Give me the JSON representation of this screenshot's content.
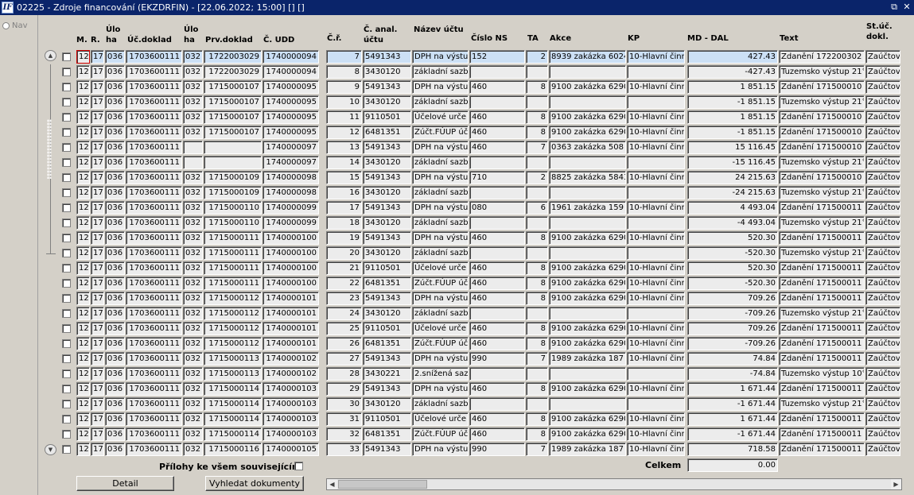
{
  "window": {
    "title": "02225 - Zdroje financování (EKZDRFIN) - [22.06.2022; 15:00] [] []",
    "logo_text": "IF",
    "restore_glyph": "⧉",
    "close_glyph": "✕"
  },
  "nav": {
    "label": "Nav"
  },
  "columns": {
    "m": "M.",
    "r": "R.",
    "uloha1": "Úlo\nha",
    "ucdoklad": "Úč.doklad",
    "uloha2": "Úlo\nha",
    "prvdoklad": "Prv.doklad",
    "cudd": "Č. UDD",
    "cr": "Č.ř.",
    "canal": "Č. anal.\núčtu",
    "nazev": "Název účtu",
    "cislons": "Číslo NS",
    "ta": "TA",
    "akce": "Akce",
    "kp": "KP",
    "mddal": "MD - DAL",
    "text": "Text",
    "stuc": "St.úč.\ndokl."
  },
  "rows": [
    {
      "m": "12",
      "r": "17",
      "u1": "036",
      "ucd": "1703600111",
      "u2": "032",
      "prv": "1722003029",
      "udd": "1740000094",
      "cr": "7",
      "anal": "5491343",
      "naz": "DPH na výstu",
      "ns": "152",
      "ta": "2",
      "akce": "8939 zakázka 6024",
      "kp": "10-Hlavní činn",
      "md": "427.43",
      "txt": "Zdanění 172200302",
      "st": "Zaúčtov"
    },
    {
      "m": "12",
      "r": "17",
      "u1": "036",
      "ucd": "1703600111",
      "u2": "032",
      "prv": "1722003029",
      "udd": "1740000094",
      "cr": "8",
      "anal": "3430120",
      "naz": "základní sazb",
      "ns": "",
      "ta": "",
      "akce": "",
      "kp": "",
      "md": "-427.43",
      "txt": "Tuzemsko výstup 21°",
      "st": "Zaúčtov"
    },
    {
      "m": "12",
      "r": "17",
      "u1": "036",
      "ucd": "1703600111",
      "u2": "032",
      "prv": "1715000107",
      "udd": "1740000095",
      "cr": "9",
      "anal": "5491343",
      "naz": "DPH na výstu",
      "ns": "460",
      "ta": "8",
      "akce": "9100 zakázka 6290",
      "kp": "10-Hlavní činn",
      "md": "1 851.15",
      "txt": "Zdanění 171500010",
      "st": "Zaúčtov"
    },
    {
      "m": "12",
      "r": "17",
      "u1": "036",
      "ucd": "1703600111",
      "u2": "032",
      "prv": "1715000107",
      "udd": "1740000095",
      "cr": "10",
      "anal": "3430120",
      "naz": "základní sazb",
      "ns": "",
      "ta": "",
      "akce": "",
      "kp": "",
      "md": "-1 851.15",
      "txt": "Tuzemsko výstup 21°",
      "st": "Zaúčtov"
    },
    {
      "m": "12",
      "r": "17",
      "u1": "036",
      "ucd": "1703600111",
      "u2": "032",
      "prv": "1715000107",
      "udd": "1740000095",
      "cr": "11",
      "anal": "9110501",
      "naz": "Účelové urče",
      "ns": "460",
      "ta": "8",
      "akce": "9100 zakázka 6290",
      "kp": "10-Hlavní činn",
      "md": "1 851.15",
      "txt": "Zdanění 171500010",
      "st": "Zaúčtov"
    },
    {
      "m": "12",
      "r": "17",
      "u1": "036",
      "ucd": "1703600111",
      "u2": "032",
      "prv": "1715000107",
      "udd": "1740000095",
      "cr": "12",
      "anal": "6481351",
      "naz": "Zúčt.FÚUP úč",
      "ns": "460",
      "ta": "8",
      "akce": "9100 zakázka 6290",
      "kp": "10-Hlavní činn",
      "md": "-1 851.15",
      "txt": "Zdanění 171500010",
      "st": "Zaúčtov"
    },
    {
      "m": "12",
      "r": "17",
      "u1": "036",
      "ucd": "1703600111",
      "u2": "",
      "prv": "",
      "udd": "1740000097",
      "cr": "13",
      "anal": "5491343",
      "naz": "DPH na výstu",
      "ns": "460",
      "ta": "7",
      "akce": "0363 zakázka 508",
      "kp": "10-Hlavní činn",
      "md": "15 116.45",
      "txt": "Zdanění 171500010",
      "st": "Zaúčtov"
    },
    {
      "m": "12",
      "r": "17",
      "u1": "036",
      "ucd": "1703600111",
      "u2": "",
      "prv": "",
      "udd": "1740000097",
      "cr": "14",
      "anal": "3430120",
      "naz": "základní sazb",
      "ns": "",
      "ta": "",
      "akce": "",
      "kp": "",
      "md": "-15 116.45",
      "txt": "Tuzemsko výstup 21°",
      "st": "Zaúčtov"
    },
    {
      "m": "12",
      "r": "17",
      "u1": "036",
      "ucd": "1703600111",
      "u2": "032",
      "prv": "1715000109",
      "udd": "1740000098",
      "cr": "15",
      "anal": "5491343",
      "naz": "DPH na výstu",
      "ns": "710",
      "ta": "2",
      "akce": "8825 zakázka 5843",
      "kp": "10-Hlavní činn",
      "md": "24 215.63",
      "txt": "Zdanění 171500010",
      "st": "Zaúčtov"
    },
    {
      "m": "12",
      "r": "17",
      "u1": "036",
      "ucd": "1703600111",
      "u2": "032",
      "prv": "1715000109",
      "udd": "1740000098",
      "cr": "16",
      "anal": "3430120",
      "naz": "základní sazb",
      "ns": "",
      "ta": "",
      "akce": "",
      "kp": "",
      "md": "-24 215.63",
      "txt": "Tuzemsko výstup 21°",
      "st": "Zaúčtov"
    },
    {
      "m": "12",
      "r": "17",
      "u1": "036",
      "ucd": "1703600111",
      "u2": "032",
      "prv": "1715000110",
      "udd": "1740000099",
      "cr": "17",
      "anal": "5491343",
      "naz": "DPH na výstu",
      "ns": "080",
      "ta": "6",
      "akce": "1961 zakázka 159",
      "kp": "10-Hlavní činn",
      "md": "4 493.04",
      "txt": "Zdanění 171500011",
      "st": "Zaúčtov"
    },
    {
      "m": "12",
      "r": "17",
      "u1": "036",
      "ucd": "1703600111",
      "u2": "032",
      "prv": "1715000110",
      "udd": "1740000099",
      "cr": "18",
      "anal": "3430120",
      "naz": "základní sazb",
      "ns": "",
      "ta": "",
      "akce": "",
      "kp": "",
      "md": "-4 493.04",
      "txt": "Tuzemsko výstup 21°",
      "st": "Zaúčtov"
    },
    {
      "m": "12",
      "r": "17",
      "u1": "036",
      "ucd": "1703600111",
      "u2": "032",
      "prv": "1715000111",
      "udd": "1740000100",
      "cr": "19",
      "anal": "5491343",
      "naz": "DPH na výstu",
      "ns": "460",
      "ta": "8",
      "akce": "9100 zakázka 6290",
      "kp": "10-Hlavní činn",
      "md": "520.30",
      "txt": "Zdanění 171500011",
      "st": "Zaúčtov"
    },
    {
      "m": "12",
      "r": "17",
      "u1": "036",
      "ucd": "1703600111",
      "u2": "032",
      "prv": "1715000111",
      "udd": "1740000100",
      "cr": "20",
      "anal": "3430120",
      "naz": "základní sazb",
      "ns": "",
      "ta": "",
      "akce": "",
      "kp": "",
      "md": "-520.30",
      "txt": "Tuzemsko výstup 21°",
      "st": "Zaúčtov"
    },
    {
      "m": "12",
      "r": "17",
      "u1": "036",
      "ucd": "1703600111",
      "u2": "032",
      "prv": "1715000111",
      "udd": "1740000100",
      "cr": "21",
      "anal": "9110501",
      "naz": "Účelové urče",
      "ns": "460",
      "ta": "8",
      "akce": "9100 zakázka 6290",
      "kp": "10-Hlavní činn",
      "md": "520.30",
      "txt": "Zdanění 171500011",
      "st": "Zaúčtov"
    },
    {
      "m": "12",
      "r": "17",
      "u1": "036",
      "ucd": "1703600111",
      "u2": "032",
      "prv": "1715000111",
      "udd": "1740000100",
      "cr": "22",
      "anal": "6481351",
      "naz": "Zúčt.FÚUP úč",
      "ns": "460",
      "ta": "8",
      "akce": "9100 zakázka 6290",
      "kp": "10-Hlavní činn",
      "md": "-520.30",
      "txt": "Zdanění 171500011",
      "st": "Zaúčtov"
    },
    {
      "m": "12",
      "r": "17",
      "u1": "036",
      "ucd": "1703600111",
      "u2": "032",
      "prv": "1715000112",
      "udd": "1740000101",
      "cr": "23",
      "anal": "5491343",
      "naz": "DPH na výstu",
      "ns": "460",
      "ta": "8",
      "akce": "9100 zakázka 6290",
      "kp": "10-Hlavní činn",
      "md": "709.26",
      "txt": "Zdanění 171500011",
      "st": "Zaúčtov"
    },
    {
      "m": "12",
      "r": "17",
      "u1": "036",
      "ucd": "1703600111",
      "u2": "032",
      "prv": "1715000112",
      "udd": "1740000101",
      "cr": "24",
      "anal": "3430120",
      "naz": "základní sazb",
      "ns": "",
      "ta": "",
      "akce": "",
      "kp": "",
      "md": "-709.26",
      "txt": "Tuzemsko výstup 21°",
      "st": "Zaúčtov"
    },
    {
      "m": "12",
      "r": "17",
      "u1": "036",
      "ucd": "1703600111",
      "u2": "032",
      "prv": "1715000112",
      "udd": "1740000101",
      "cr": "25",
      "anal": "9110501",
      "naz": "Účelové urče",
      "ns": "460",
      "ta": "8",
      "akce": "9100 zakázka 6290",
      "kp": "10-Hlavní činn",
      "md": "709.26",
      "txt": "Zdanění 171500011",
      "st": "Zaúčtov"
    },
    {
      "m": "12",
      "r": "17",
      "u1": "036",
      "ucd": "1703600111",
      "u2": "032",
      "prv": "1715000112",
      "udd": "1740000101",
      "cr": "26",
      "anal": "6481351",
      "naz": "Zúčt.FÚUP úč",
      "ns": "460",
      "ta": "8",
      "akce": "9100 zakázka 6290",
      "kp": "10-Hlavní činn",
      "md": "-709.26",
      "txt": "Zdanění 171500011",
      "st": "Zaúčtov"
    },
    {
      "m": "12",
      "r": "17",
      "u1": "036",
      "ucd": "1703600111",
      "u2": "032",
      "prv": "1715000113",
      "udd": "1740000102",
      "cr": "27",
      "anal": "5491343",
      "naz": "DPH na výstu",
      "ns": "990",
      "ta": "7",
      "akce": "1989 zakázka 187",
      "kp": "10-Hlavní činn",
      "md": "74.84",
      "txt": "Zdanění 171500011",
      "st": "Zaúčtov"
    },
    {
      "m": "12",
      "r": "17",
      "u1": "036",
      "ucd": "1703600111",
      "u2": "032",
      "prv": "1715000113",
      "udd": "1740000102",
      "cr": "28",
      "anal": "3430221",
      "naz": "2.snížená saz",
      "ns": "",
      "ta": "",
      "akce": "",
      "kp": "",
      "md": "-74.84",
      "txt": "Tuzemsko výstup 10°",
      "st": "Zaúčtov"
    },
    {
      "m": "12",
      "r": "17",
      "u1": "036",
      "ucd": "1703600111",
      "u2": "032",
      "prv": "1715000114",
      "udd": "1740000103",
      "cr": "29",
      "anal": "5491343",
      "naz": "DPH na výstu",
      "ns": "460",
      "ta": "8",
      "akce": "9100 zakázka 6290",
      "kp": "10-Hlavní činn",
      "md": "1 671.44",
      "txt": "Zdanění 171500011",
      "st": "Zaúčtov"
    },
    {
      "m": "12",
      "r": "17",
      "u1": "036",
      "ucd": "1703600111",
      "u2": "032",
      "prv": "1715000114",
      "udd": "1740000103",
      "cr": "30",
      "anal": "3430120",
      "naz": "základní sazb",
      "ns": "",
      "ta": "",
      "akce": "",
      "kp": "",
      "md": "-1 671.44",
      "txt": "Tuzemsko výstup 21°",
      "st": "Zaúčtov"
    },
    {
      "m": "12",
      "r": "17",
      "u1": "036",
      "ucd": "1703600111",
      "u2": "032",
      "prv": "1715000114",
      "udd": "1740000103",
      "cr": "31",
      "anal": "9110501",
      "naz": "Účelové urče",
      "ns": "460",
      "ta": "8",
      "akce": "9100 zakázka 6290",
      "kp": "10-Hlavní činn",
      "md": "1 671.44",
      "txt": "Zdanění 171500011",
      "st": "Zaúčtov"
    },
    {
      "m": "12",
      "r": "17",
      "u1": "036",
      "ucd": "1703600111",
      "u2": "032",
      "prv": "1715000114",
      "udd": "1740000103",
      "cr": "32",
      "anal": "6481351",
      "naz": "Zúčt.FÚUP úč",
      "ns": "460",
      "ta": "8",
      "akce": "9100 zakázka 6290",
      "kp": "10-Hlavní činn",
      "md": "-1 671.44",
      "txt": "Zdanění 171500011",
      "st": "Zaúčtov"
    },
    {
      "m": "12",
      "r": "17",
      "u1": "036",
      "ucd": "1703600111",
      "u2": "032",
      "prv": "1715000116",
      "udd": "1740000105",
      "cr": "33",
      "anal": "5491343",
      "naz": "DPH na výstu",
      "ns": "990",
      "ta": "7",
      "akce": "1989 zakázka 187",
      "kp": "10-Hlavní činn",
      "md": "718.58",
      "txt": "Zdanění 171500011",
      "st": "Zaúčtov"
    }
  ],
  "footer": {
    "attachments_label": "Přílohy ke všem souvisejícím",
    "total_label": "Celkem",
    "total_value": "0.00",
    "detail_button": "Detail",
    "search_docs_button": "Vyhledat dokumenty",
    "scroll_up_glyph": "▲",
    "scroll_down_glyph": "▼",
    "scroll_left_glyph": "◀",
    "scroll_right_glyph": "▶"
  }
}
